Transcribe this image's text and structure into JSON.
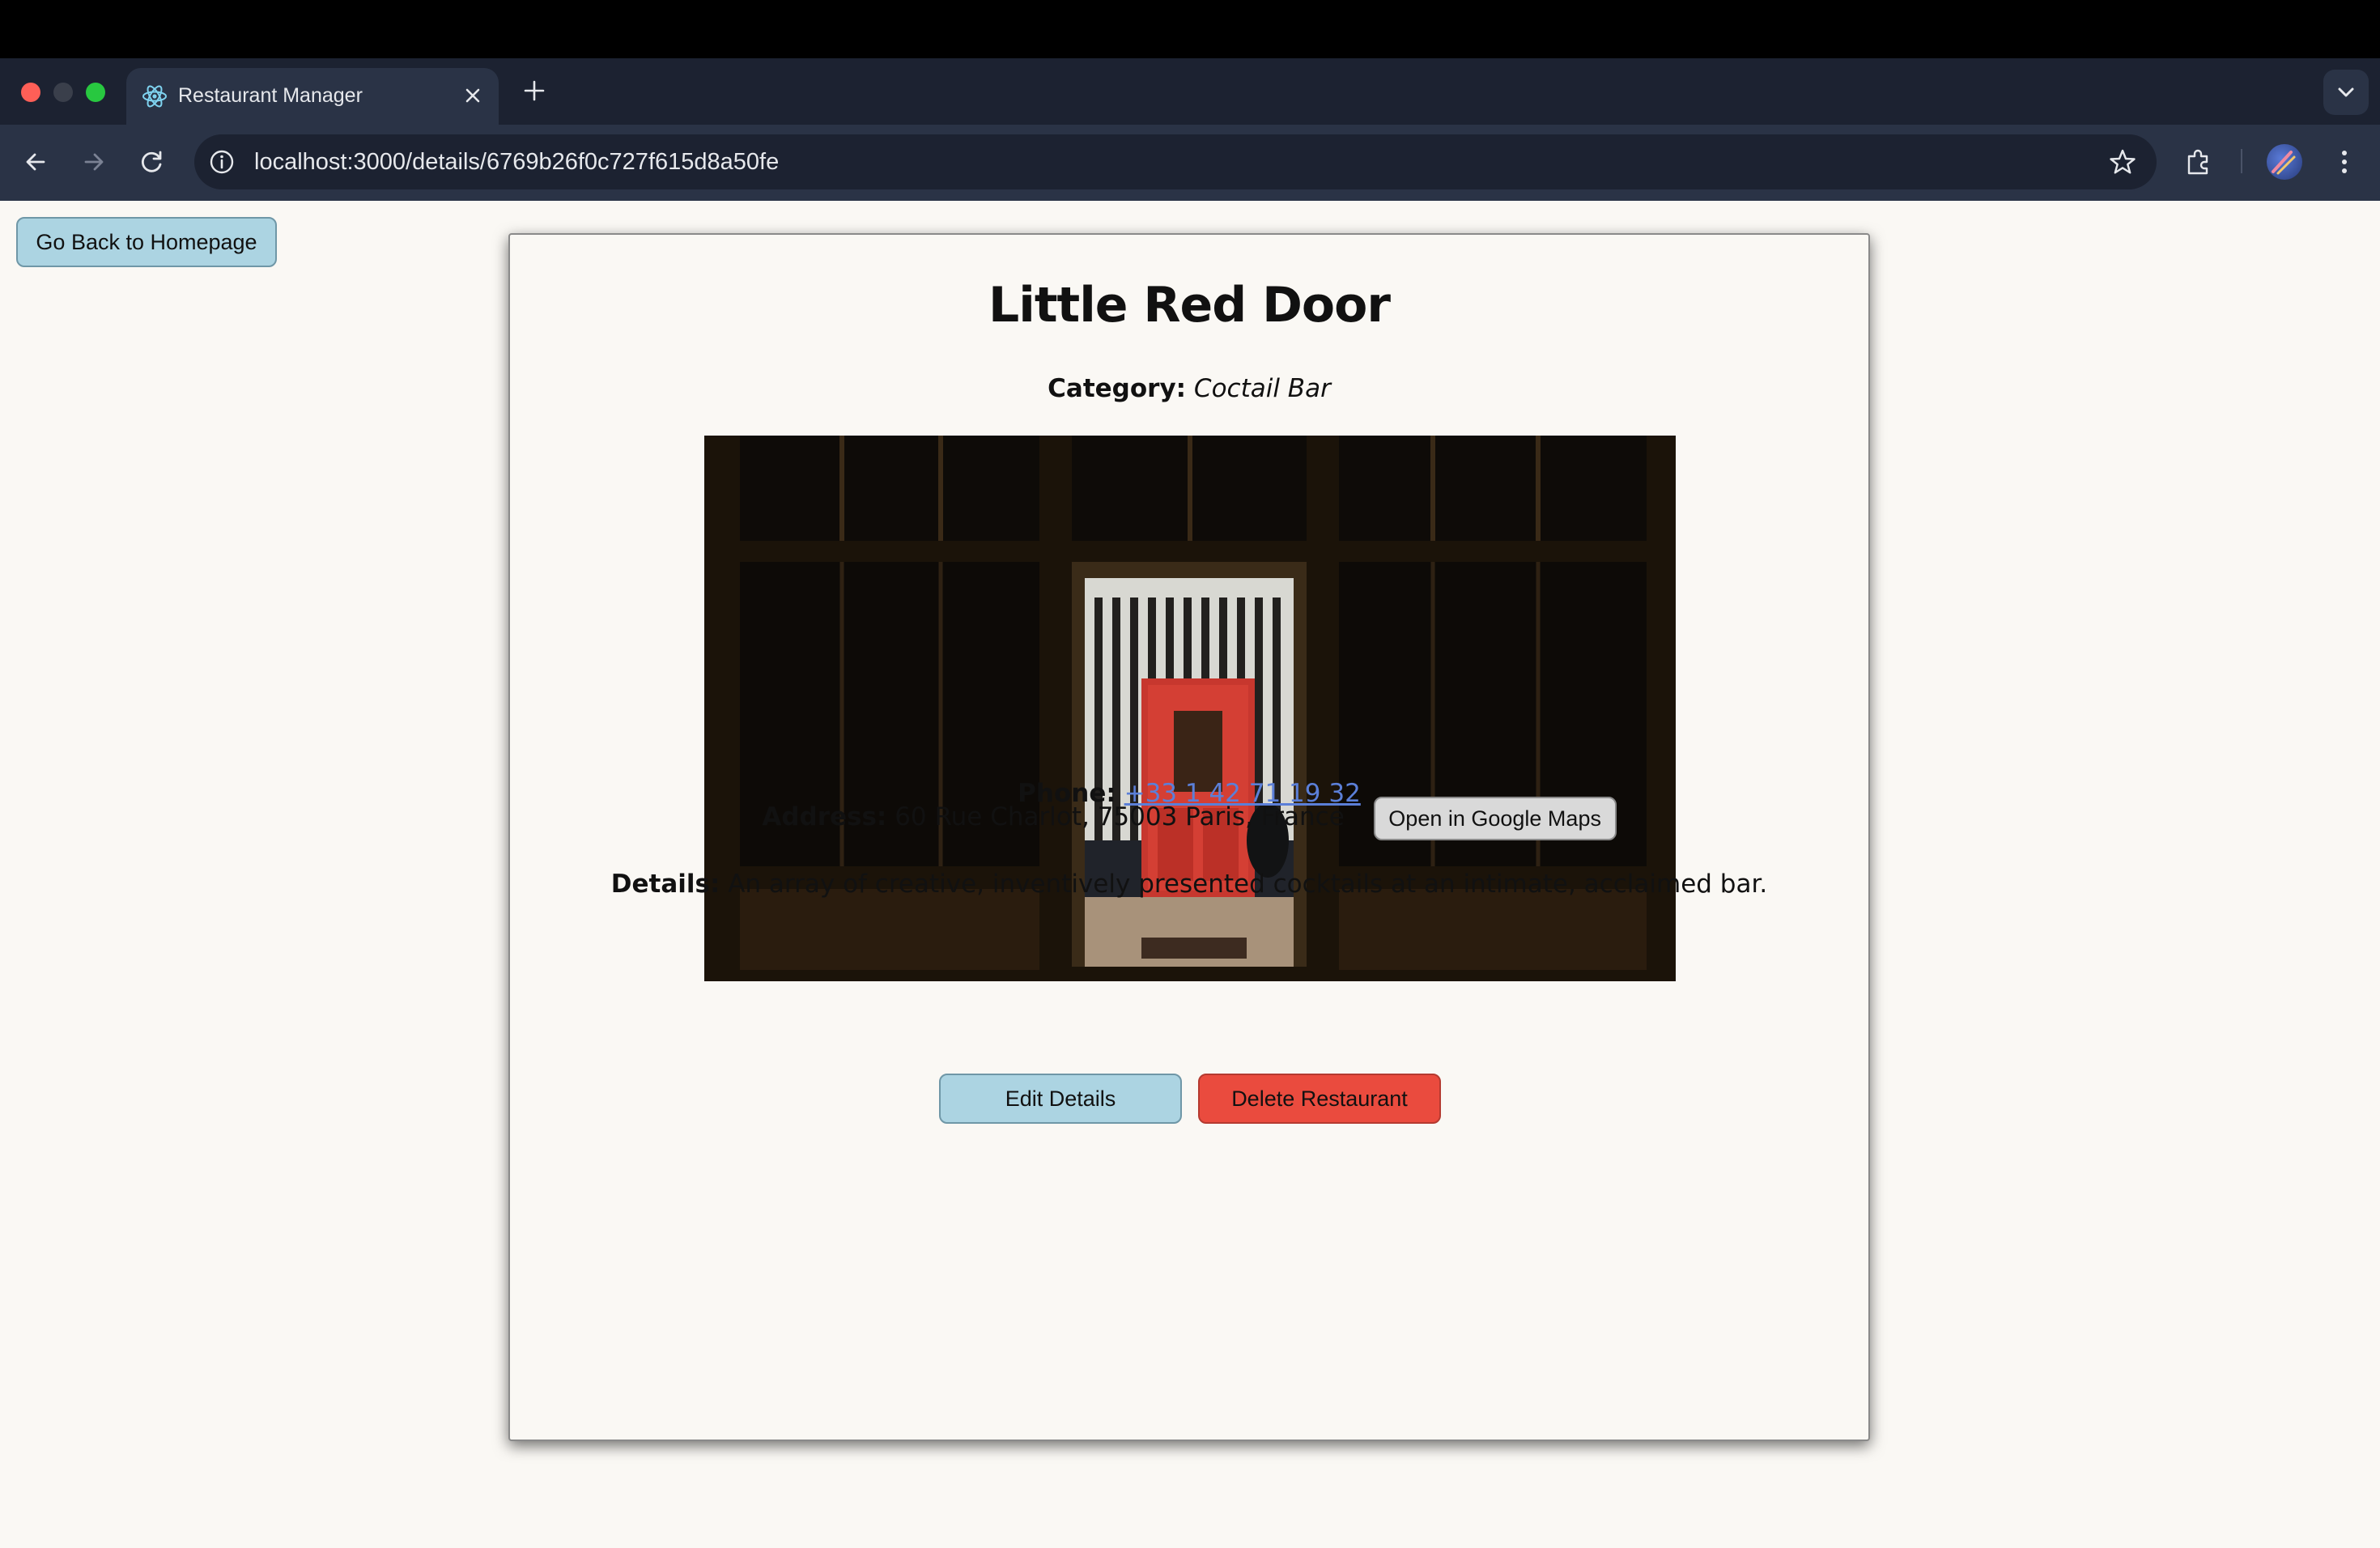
{
  "browser": {
    "tab_title": "Restaurant Manager",
    "url": "localhost:3000/details/6769b26f0c727f615d8a50fe",
    "icons": [
      "react-icon",
      "close-icon",
      "plus-icon",
      "chevron-down-icon",
      "back-arrow-icon",
      "forward-arrow-icon",
      "reload-icon",
      "info-icon",
      "star-icon",
      "extensions-icon",
      "kebab-menu-icon"
    ]
  },
  "page": {
    "back_button": "Go Back to Homepage",
    "restaurant": {
      "name": "Little Red Door",
      "category_label": "Category:",
      "category": "Coctail Bar",
      "address_label": "Address:",
      "address": "60 Rue Charlot, 75003 Paris, France",
      "maps_button": "Open in Google Maps",
      "phone_label": "Phone:",
      "phone": "+33 1 42 71 19 32",
      "details_label": "Details:",
      "details": "An array of creative, inventively presented cocktails at an intimate, acclaimed bar."
    },
    "edit_button": "Edit Details",
    "delete_button": "Delete Restaurant"
  },
  "colors": {
    "page_background": "#faf8f4",
    "primary_button": "#acd4e2",
    "danger_button": "#ea4b3e",
    "link": "#5b7fd8"
  }
}
